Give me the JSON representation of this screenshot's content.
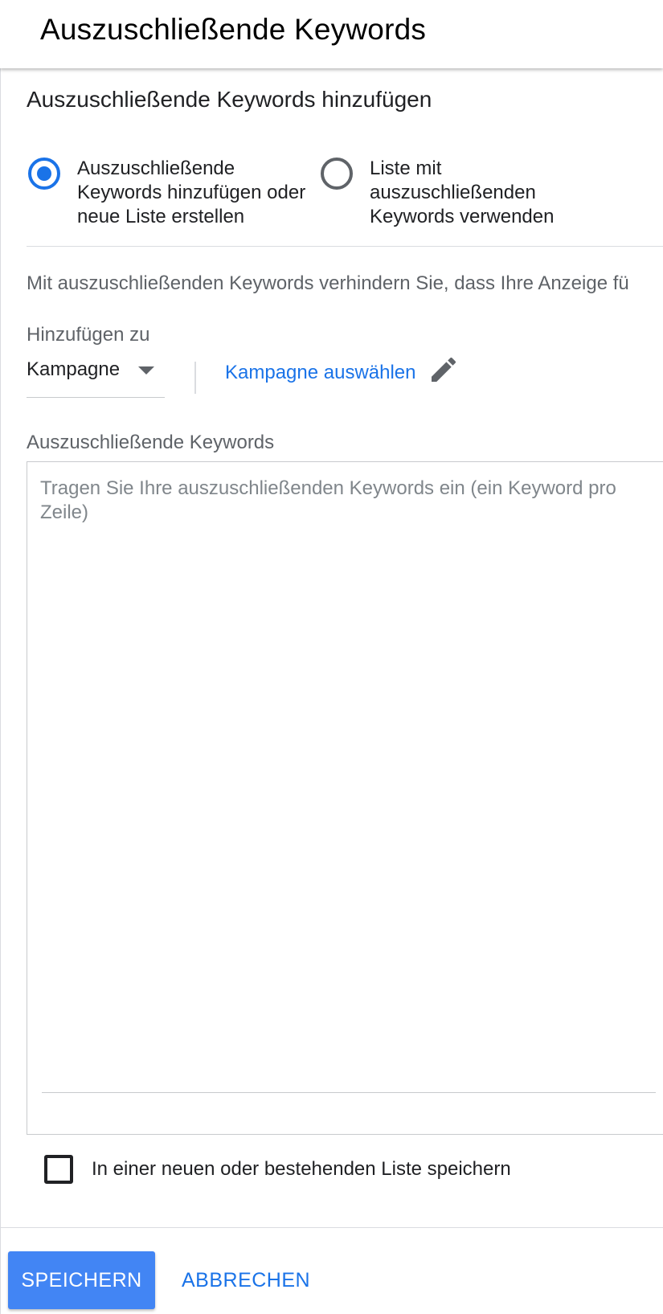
{
  "header": {
    "title": "Auszuschließende Keywords"
  },
  "section": {
    "title": "Auszuschließende Keywords hinzufügen"
  },
  "radio_options": [
    {
      "label": "Auszuschließende Keywords hinzufügen oder neue Liste erstellen",
      "selected": true
    },
    {
      "label": "Liste mit auszuschließenden Keywords verwenden",
      "selected": false
    }
  ],
  "description": "Mit auszuschließenden Keywords verhindern Sie, dass Ihre Anzeige fü",
  "add_to": {
    "label": "Hinzufügen zu",
    "value": "Kampagne",
    "link_label": "Kampagne auswählen"
  },
  "keywords": {
    "label": "Auszuschließende Keywords",
    "placeholder": "Tragen Sie Ihre auszuschließenden Keywords ein (ein Keyword pro Zeile)",
    "value": ""
  },
  "save_to_list": {
    "label": "In einer neuen oder bestehenden Liste speichern",
    "checked": false
  },
  "footer": {
    "save_label": "SPEICHERN",
    "cancel_label": "ABBRECHEN"
  },
  "colors": {
    "accent": "#1a73e8",
    "primary_button": "#4285f4",
    "text": "#202124",
    "secondary_text": "#5f6368"
  },
  "icons": {
    "edit": "pencil-icon",
    "dropdown": "caret-down-icon"
  }
}
